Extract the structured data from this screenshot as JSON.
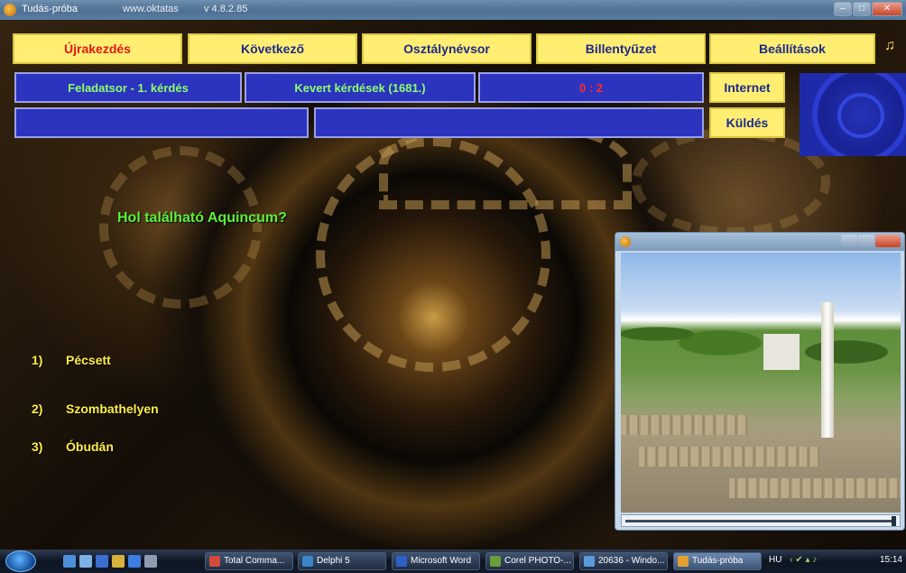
{
  "window": {
    "title": "Tudás-próba",
    "url": "www.oktatas",
    "version": "v 4.8.2.85"
  },
  "toolbar": {
    "restart": "Újrakezdés",
    "next": "Következő",
    "class_list": "Osztálynévsor",
    "keyboard": "Billentyűzet",
    "settings": "Beállítások"
  },
  "info": {
    "task": "Feladatsor - 1. kérdés",
    "mode": "Kevert kérdések  (1681.)",
    "score": "0 : 2",
    "blank1": "",
    "blank2": ""
  },
  "side": {
    "internet": "Internet",
    "send": "Küldés"
  },
  "question": "Hol található Aquincum?",
  "answers": [
    {
      "num": "1)",
      "text": "Pécsett"
    },
    {
      "num": "2)",
      "text": "Szombathelyen"
    },
    {
      "num": "3)",
      "text": "Óbudán"
    }
  ],
  "slider": {
    "position": 1.0
  },
  "taskbar": {
    "items": [
      {
        "label": "Total Comma..."
      },
      {
        "label": "Delphi 5"
      },
      {
        "label": "Microsoft Word"
      },
      {
        "label": "Corel PHOTO-..."
      },
      {
        "label": "20636 - Windo..."
      },
      {
        "label": "Tudás-próba"
      }
    ],
    "lang": "HU",
    "clock": "15:14"
  },
  "colors": {
    "button_bg": "#ffee72",
    "panel_bg": "#2c33bf",
    "answer_text": "#ffee4a",
    "question_text": "#5cf03c",
    "score_text": "#ff2a2a"
  }
}
